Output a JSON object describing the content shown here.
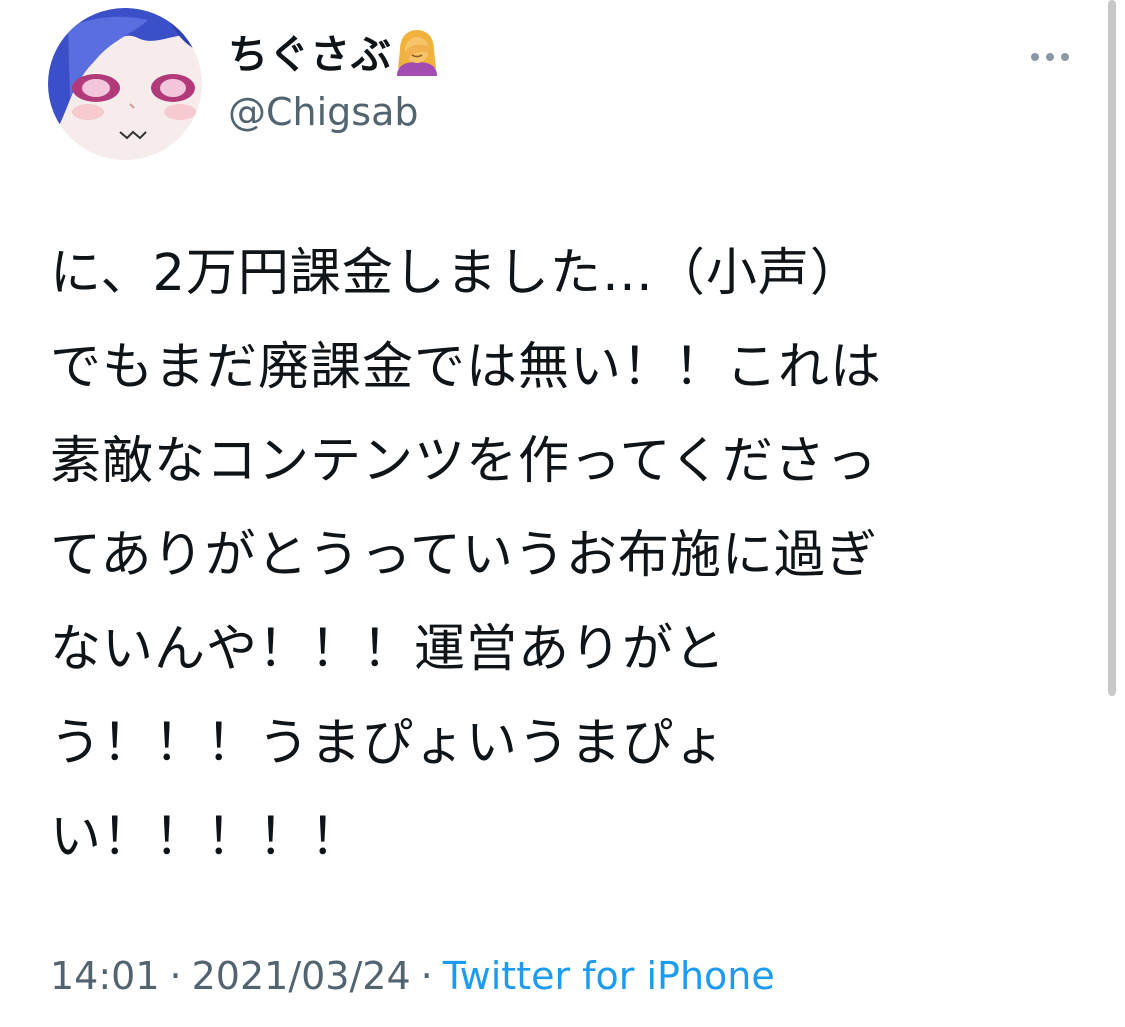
{
  "tweet": {
    "display_name": "ちぐさぶ",
    "handle": "@Chigsab",
    "text_lines": [
      "に、2万円課金しました…（小声）",
      "でもまだ廃課金では無い！！これは",
      "素敵なコンテンツを作ってくださっ",
      "てありがとうっていうお布施に過ぎ",
      "ないんや！！！運営ありがと",
      "う！！！うまぴょいうまぴょ",
      "い！！！！！"
    ],
    "time": "14:01",
    "date": "2021/03/24",
    "separator": "·",
    "source": "Twitter for iPhone"
  },
  "icons": {
    "name_emoji": "facepalm-icon",
    "more": "more-dots-icon"
  },
  "colors": {
    "text": "#0f1419",
    "secondary_text": "#536471",
    "link": "#1d9bf0"
  }
}
